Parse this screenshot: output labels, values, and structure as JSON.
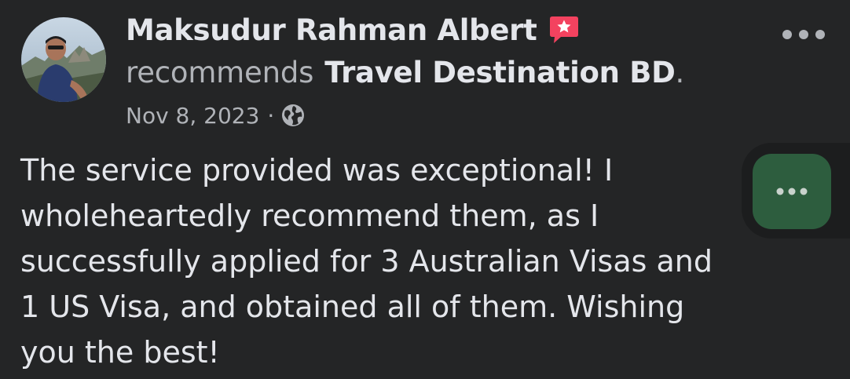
{
  "post": {
    "author_name": "Maksudur Rahman Albert",
    "recommend_verb": "recommends",
    "page_name": "Travel Destination BD",
    "page_suffix": ".",
    "date": "Nov 8, 2023",
    "separator": "·",
    "audience_icon": "globe-icon",
    "body_lines": [
      "The service provided was exceptional! I",
      "wholeheartedly recommend them, as I",
      "successfully applied for 3 Australian Visas and",
      "1 US Visa, and obtained all of them. Wishing",
      "you the best!"
    ]
  },
  "icons": {
    "recommendation": "recommendation-badge-icon",
    "more": "more-options-icon",
    "chat": "chat-typing-icon"
  },
  "colors": {
    "background": "#242526",
    "primary_text": "#e4e6eb",
    "secondary_text": "#b0b3b8",
    "badge": "#f3425f",
    "chat_bubble": "#2d5d3e"
  }
}
